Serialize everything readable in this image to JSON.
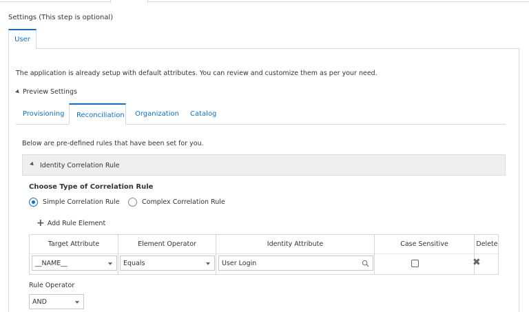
{
  "section_title": "Settings (This step is optional)",
  "user_tab": {
    "label": "User"
  },
  "info_text": "The application is already setup with default attributes. You can review and customize them as per your need.",
  "preview": {
    "label": "Preview Settings"
  },
  "subtabs": [
    {
      "label": "Provisioning",
      "active": false
    },
    {
      "label": "Reconciliation",
      "active": true
    },
    {
      "label": "Organization",
      "active": false
    },
    {
      "label": "Catalog",
      "active": false
    }
  ],
  "rules_intro": "Below are pre-defined rules that have been set for you.",
  "correlation_header": {
    "label": "Identity Correlation Rule"
  },
  "choose_title": "Choose Type of Correlation Rule",
  "radios": [
    {
      "label": "Simple Correlation Rule",
      "checked": true
    },
    {
      "label": "Complex Correlation Rule",
      "checked": false
    }
  ],
  "add_rule_label": "Add Rule Element",
  "table": {
    "headers": [
      "Target Attribute",
      "Element Operator",
      "Identity Attribute",
      "Case Sensitive",
      "Delete"
    ],
    "row": {
      "target_attribute": "__NAME__",
      "element_operator": "Equals",
      "identity_attribute": "User Login",
      "case_sensitive": false
    }
  },
  "rule_operator": {
    "label": "Rule Operator",
    "value": "AND"
  },
  "colors": {
    "accent": "#0572ce",
    "border": "#d7d7d7",
    "header_bg": "#efefef"
  }
}
